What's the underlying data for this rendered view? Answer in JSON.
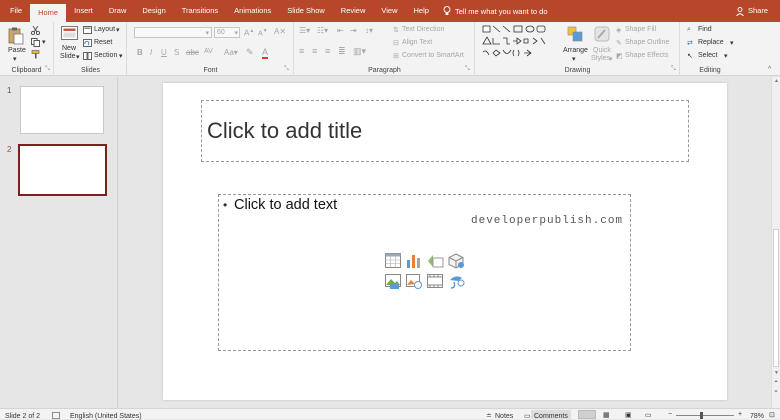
{
  "tabs": [
    "File",
    "Home",
    "Insert",
    "Draw",
    "Design",
    "Transitions",
    "Animations",
    "Slide Show",
    "Review",
    "View",
    "Help"
  ],
  "tell_me": "Tell me what you want to do",
  "share": "Share",
  "ribbon": {
    "clipboard": {
      "label": "Clipboard",
      "paste": "Paste"
    },
    "slides": {
      "label": "Slides",
      "new_slide_1": "New",
      "new_slide_2": "Slide",
      "layout": "Layout",
      "reset": "Reset",
      "section": "Section"
    },
    "font": {
      "label": "Font",
      "size": "60"
    },
    "paragraph": {
      "label": "Paragraph",
      "text_direction": "Text Direction",
      "align_text": "Align Text",
      "convert_smartart": "Convert to SmartArt"
    },
    "drawing": {
      "label": "Drawing",
      "arrange": "Arrange",
      "quick_styles_1": "Quick",
      "quick_styles_2": "Styles",
      "shape_fill": "Shape Fill",
      "shape_outline": "Shape Outline",
      "shape_effects": "Shape Effects"
    },
    "editing": {
      "label": "Editing",
      "find": "Find",
      "replace": "Replace",
      "select": "Select"
    }
  },
  "thumbnails": [
    {
      "num": "1"
    },
    {
      "num": "2"
    }
  ],
  "slide": {
    "title_placeholder": "Click to add title",
    "body_placeholder": "Click to add text",
    "watermark": "developerpublish.com"
  },
  "status": {
    "slide_info": "Slide 2 of 2",
    "language": "English (United States)",
    "notes": "Notes",
    "comments": "Comments",
    "zoom": "78%"
  },
  "colors": {
    "accent": "#b7472a",
    "selected_thumb": "#7b1f1f"
  }
}
